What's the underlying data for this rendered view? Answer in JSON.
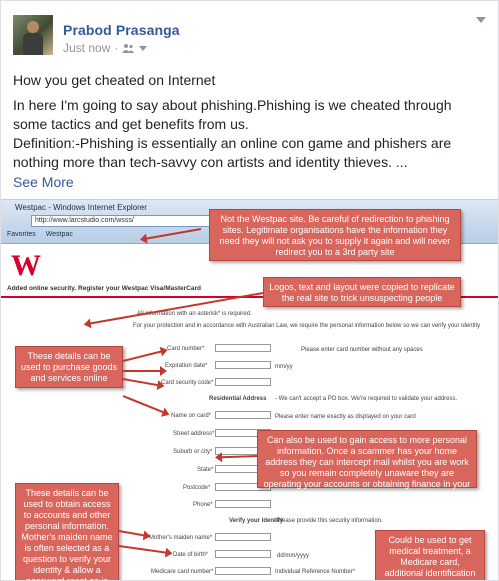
{
  "post": {
    "author": "Prabod Prasanga",
    "time": "Just now",
    "title": "How you get cheated on Internet",
    "body": [
      "In here I'm going to say about phishing.Phishing is we cheated through some tactics and get benefits from us.",
      "Definition:-Phishing is essentially an online con game and phishers are nothing more than tech-savvy con artists and identity thieves. ..."
    ],
    "see_more": "See More"
  },
  "icons": {
    "privacy": "people-icon",
    "menu": "chevron-down-icon"
  },
  "screenshot": {
    "window_title": "Westpac - Windows Internet Explorer",
    "address": "http://www.larcstudio.com/wsss/",
    "tab_favorites": "Favorites",
    "tab_site": "Westpac",
    "logo": "W",
    "banner": "Added online security. Register your Westpac Visa/MasterCard",
    "form_intro_1": "All information with an asterisk* is required.",
    "form_intro_2": "For your protection and in accordance with Australian Law, we require the personal information below so we can verify your identity",
    "fields": [
      "Card number*",
      "Expiration date*",
      "Card security code*",
      "Name on card*",
      "Street address*",
      "Suburb or city*",
      "State*",
      "Postcode*",
      "Phone*",
      "Mother's maiden name*",
      "Date of birth*",
      "Medicare card number*"
    ],
    "hint_card": "Please enter card number without any spaces",
    "hint_exp": "mm/yy",
    "residential": "Residential Address",
    "residential_note": "- We can't accept a PO box. We're required to validate your address.",
    "hint_name": "Please enter name exactly as displayed on your card",
    "verify": "Verify your Identity",
    "verify_note": "- Please provide this security information.",
    "hint_dob": "dd/mm/yyyy",
    "hint_irn": "Individual Reference Number*",
    "callouts": [
      "Not the Westpac site.  Be careful of redirection to phishing sites. Legitimate organisations have the information they need they will not ask you to supply it again and will never redirect you to a 3rd party site",
      "Logos, text and layout were copied to replicate the real site to trick unsuspecting people",
      "These details can be used to purchase goods and services online",
      "Can also be used to gain access to more personal information.  Once a scammer has your home address they can intercept mail whilst you are work so you remain completely unaware they are operating your accounts or obtaining finance in your name",
      "These details can be used to obtain access to accounts and other personal information. Mother's maiden name is often selected as a question to verify your identity & allow a password reset as is",
      "Could be used to get medical treatment, a Medicare card, additional identification documents or to obtain"
    ]
  }
}
